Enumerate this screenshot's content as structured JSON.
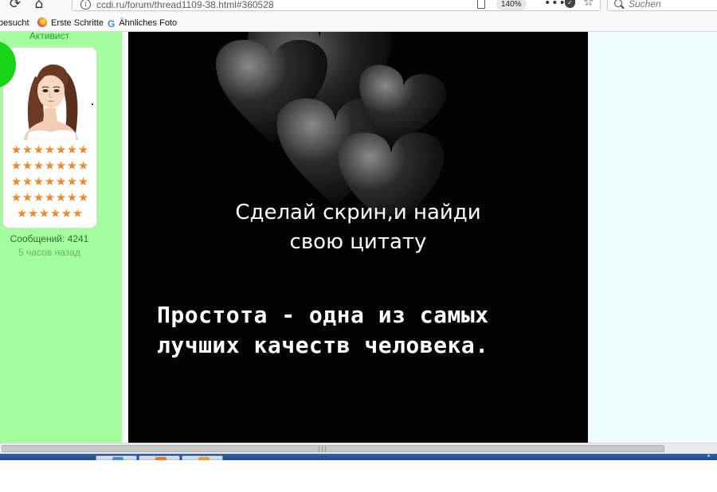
{
  "browser": {
    "url": "ccdi.ru/forum/thread1109-38.html#360528",
    "zoom": "140%",
    "search_placeholder": "Suchen",
    "bookmarks": [
      {
        "label": "besucht",
        "icon": "none"
      },
      {
        "label": "Erste Schritte",
        "icon": "firefox-icon"
      },
      {
        "label": "Ähnliches Foto",
        "icon": "google-icon"
      }
    ]
  },
  "user": {
    "rank": "Активист",
    "messages": "Сообщений: 4241",
    "last_seen": "5 часов назад",
    "star_rows": [
      7,
      7,
      7,
      7,
      6
    ]
  },
  "post_image": {
    "line1": "Сделай скрин,и найди",
    "line2": "свою цитату",
    "line3": "Простота - одна из самых",
    "line4": "лучших качеств человека."
  },
  "colors": {
    "left_column": "#a4fe9d",
    "right_column": "#f1fefe",
    "image_background": "#030303",
    "star": "#e8822a"
  }
}
